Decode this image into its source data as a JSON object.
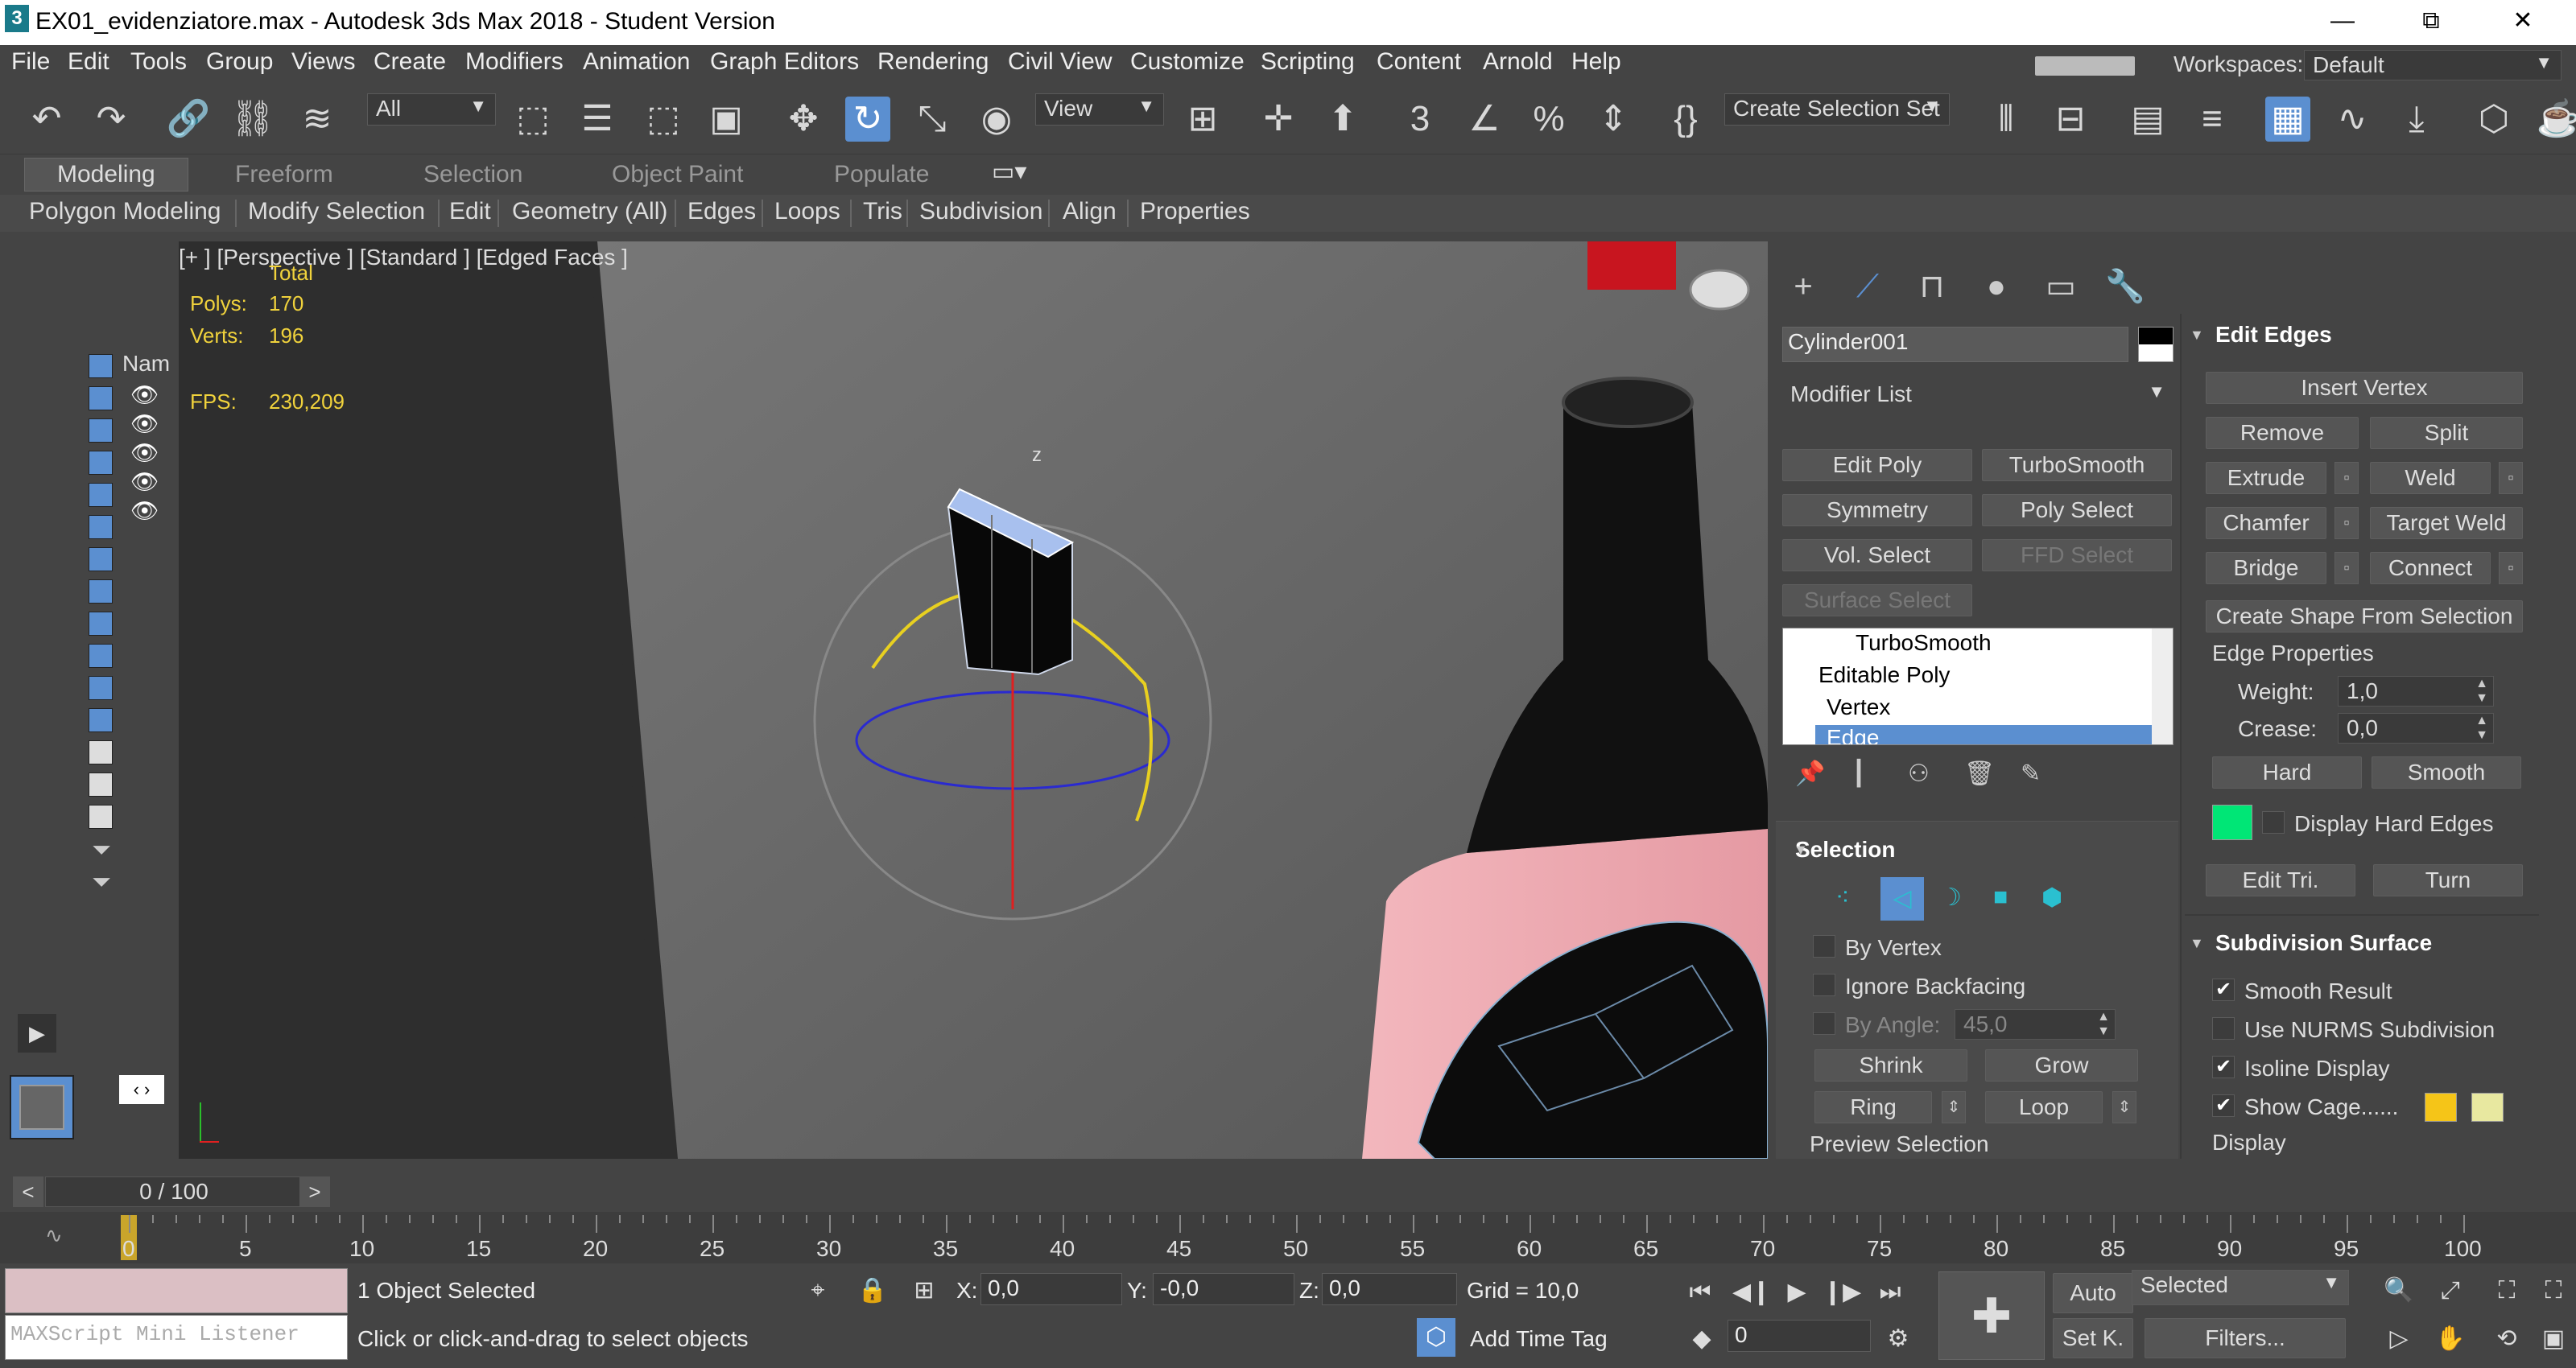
{
  "window": {
    "title": "EX01_evidenziatore.max - Autodesk 3ds Max 2018 - Student Version",
    "minimize": "—",
    "maximize": "⧉",
    "close": "✕"
  },
  "menu": [
    "File",
    "Edit",
    "Tools",
    "Group",
    "Views",
    "Create",
    "Modifiers",
    "Animation",
    "Graph Editors",
    "Rendering",
    "Civil View",
    "Customize",
    "Scripting",
    "Content",
    "Arnold",
    "Help"
  ],
  "workspaces": {
    "label": "Workspaces:",
    "value": "Default"
  },
  "toolbar": {
    "filter": "All",
    "ref_coord": "View",
    "selection_set": "Create Selection Set"
  },
  "ribbon": {
    "tabs": [
      "Modeling",
      "Freeform",
      "Selection",
      "Object Paint",
      "Populate"
    ],
    "panels": [
      "Polygon Modeling",
      "Modify Selection",
      "Edit",
      "Geometry (All)",
      "Edges",
      "Loops",
      "Tris",
      "Subdivision",
      "Align",
      "Properties"
    ]
  },
  "scene_explorer": {
    "header": "Nam"
  },
  "viewport": {
    "label": "[+ ] [Perspective ]  [Standard ]  [Edged Faces ]",
    "stats_total": "Total",
    "polys_label": "Polys:",
    "polys": "170",
    "verts_label": "Verts:",
    "verts": "196",
    "fps_label": "FPS:",
    "fps": "230,209",
    "axis_z": "z"
  },
  "command_panel": {
    "object_name": "Cylinder001",
    "modifier_list": "Modifier List",
    "modifier_buttons": [
      "Edit Poly",
      "TurboSmooth",
      "Symmetry",
      "Poly Select",
      "Vol. Select",
      "FFD Select",
      "Surface Select"
    ],
    "stack": [
      "TurboSmooth",
      "Editable Poly",
      "Vertex",
      "Edge"
    ],
    "selection": {
      "title": "Selection",
      "by_vertex": "By Vertex",
      "ignore_backfacing": "Ignore Backfacing",
      "by_angle": "By Angle:",
      "angle_value": "45,0",
      "shrink": "Shrink",
      "grow": "Grow",
      "ring": "Ring",
      "loop": "Loop",
      "preview": "Preview Selection"
    },
    "edit_edges": {
      "title": "Edit Edges",
      "insert_vertex": "Insert Vertex",
      "remove": "Remove",
      "split": "Split",
      "extrude": "Extrude",
      "weld": "Weld",
      "chamfer": "Chamfer",
      "target_weld": "Target Weld",
      "bridge": "Bridge",
      "connect": "Connect",
      "create_shape": "Create Shape From Selection",
      "edge_properties": "Edge Properties",
      "weight_label": "Weight:",
      "weight": "1,0",
      "crease_label": "Crease:",
      "crease": "0,0",
      "hard": "Hard",
      "smooth": "Smooth",
      "display_hard": "Display Hard Edges",
      "edit_tri": "Edit Tri.",
      "turn": "Turn"
    },
    "subdivision": {
      "title": "Subdivision Surface",
      "smooth_result": "Smooth Result",
      "use_nurms": "Use NURMS Subdivision",
      "isoline": "Isoline Display",
      "show_cage": "Show Cage......",
      "display": "Display"
    }
  },
  "timeline": {
    "frame": "0 / 100",
    "ticks": [
      "0",
      "5",
      "10",
      "15",
      "20",
      "25",
      "30",
      "35",
      "40",
      "45",
      "50",
      "55",
      "60",
      "65",
      "70",
      "75",
      "80",
      "85",
      "90",
      "95",
      "100"
    ]
  },
  "status": {
    "maxscript": "MAXScript Mini Listener",
    "selected": "1 Object Selected",
    "prompt": "Click or click-and-drag to select objects",
    "x_label": "X:",
    "x": "0,0",
    "y_label": "Y:",
    "y": "-0,0",
    "z_label": "Z:",
    "z": "0,0",
    "grid": "Grid = 10,0",
    "add_time_tag": "Add Time Tag",
    "auto": "Auto",
    "setk": "Set K.",
    "selected_dd": "Selected",
    "filters": "Filters...",
    "frame_field": "0"
  },
  "colors": {
    "accent": "#5b8fd0",
    "green_swatch": "#00e676",
    "cage1": "#f5c518",
    "cage2": "#e8e8a0"
  }
}
